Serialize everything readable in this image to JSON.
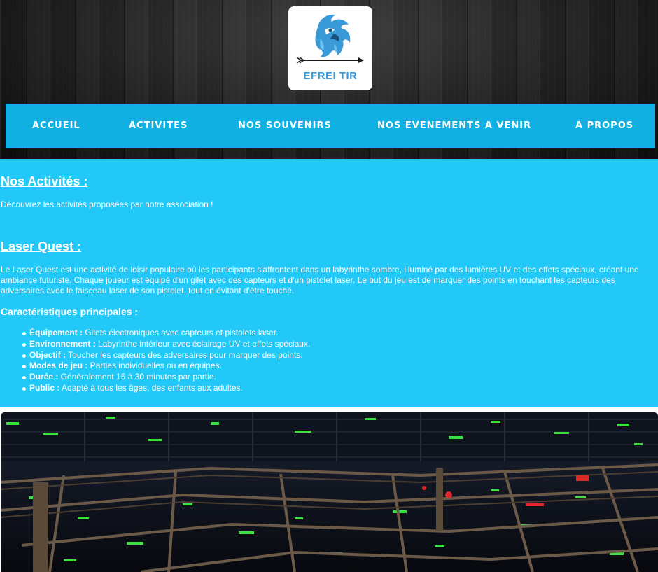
{
  "logo": {
    "text": "EFREI TIR",
    "icon": "eagle-arrow-icon"
  },
  "nav": {
    "items": [
      {
        "label": "ACCUEIL"
      },
      {
        "label": "ACTIVITES"
      },
      {
        "label": "NOS SOUVENIRS"
      },
      {
        "label": "NOS EVENEMENTS A VENIR"
      },
      {
        "label": "A PROPOS"
      }
    ]
  },
  "main": {
    "title": "Nos Activités :",
    "intro": "Découvrez les activités proposées par notre association !",
    "section_title": "Laser Quest :",
    "description": "Le Laser Quest est une activité de loisir populaire où les participants s'affrontent dans un labyrinthe sombre, illuminé par des lumières UV et des effets spéciaux, créant une ambiance futuriste. Chaque joueur est équipé d'un gilet avec des capteurs et d'un pistolet laser. Le but du jeu est de marquer des points en touchant les capteurs des adversaires avec le faisceau laser de son pistolet, tout en évitant d'être touché.",
    "features_title": "Caractéristiques principales :",
    "features": [
      {
        "label": "Équipement :",
        "text": " Gilets électroniques avec capteurs et pistolets laser."
      },
      {
        "label": "Environnement :",
        "text": " Labyrinthe intérieur avec éclairage UV et effets spéciaux."
      },
      {
        "label": "Objectif :",
        "text": " Toucher les capteurs des adversaires pour marquer des points."
      },
      {
        "label": "Modes de jeu :",
        "text": " Parties individuelles ou en équipes."
      },
      {
        "label": "Durée :",
        "text": " Généralement 15 à 30 minutes par partie."
      },
      {
        "label": "Public :",
        "text": " Adapté à tous les âges, des enfants aux adultes."
      }
    ]
  },
  "colors": {
    "nav_bg": "#10b0e2",
    "content_bg": "#22c8f7",
    "logo_blue": "#3a9ad8"
  }
}
